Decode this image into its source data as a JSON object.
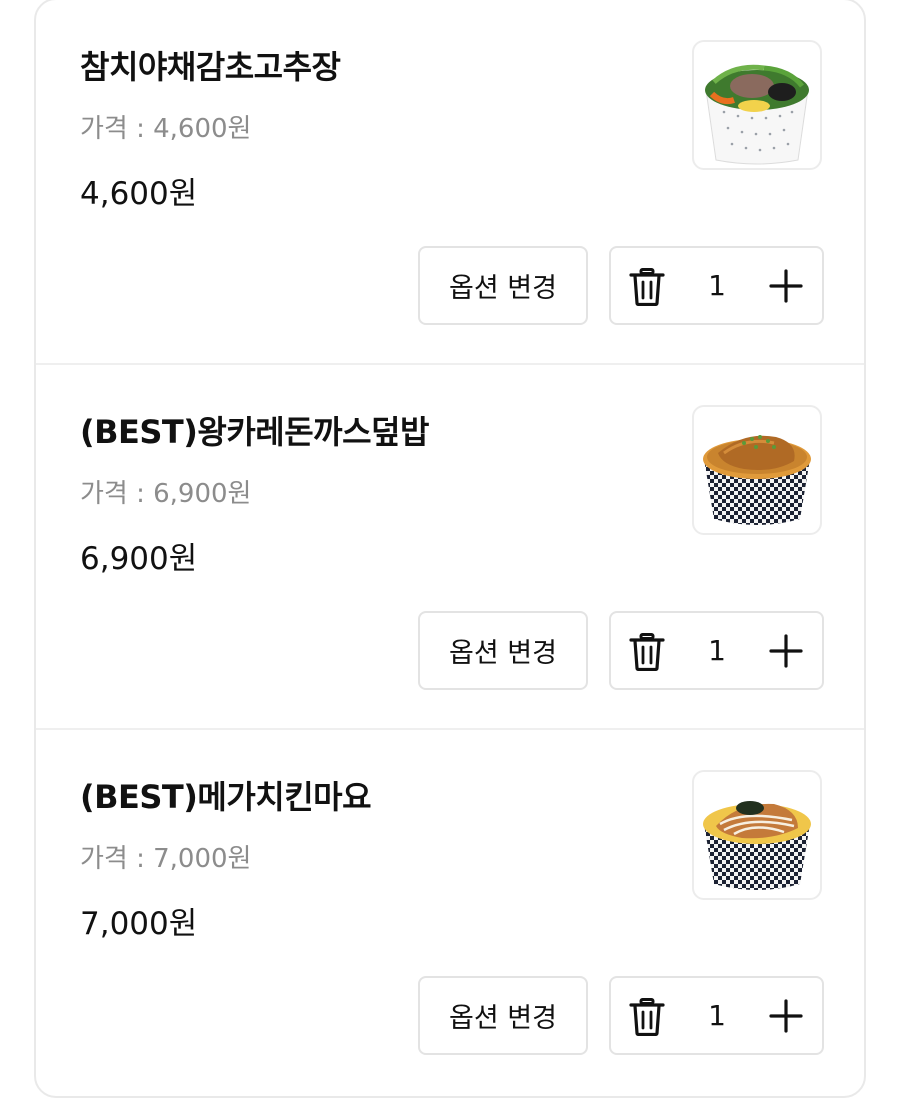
{
  "cart": {
    "items": [
      {
        "name": "참치야채감초고추장",
        "price_label": "가격 : 4,600원",
        "total": "4,600원",
        "option_label": "옵션 변경",
        "quantity": "1",
        "thumbnail_icon": "tuna-vegetable-bibimbap-bowl"
      },
      {
        "name": "(BEST)왕카레돈까스덮밥",
        "price_label": "가격 : 6,900원",
        "total": "6,900원",
        "option_label": "옵션 변경",
        "quantity": "1",
        "thumbnail_icon": "curry-pork-cutlet-rice-bowl"
      },
      {
        "name": "(BEST)메가치킨마요",
        "price_label": "가격 : 7,000원",
        "total": "7,000원",
        "option_label": "옵션 변경",
        "quantity": "1",
        "thumbnail_icon": "chicken-mayo-rice-bowl"
      }
    ]
  },
  "colors": {
    "border": "#e3e3e3",
    "muted_text": "#8c8c8c",
    "text": "#111111"
  }
}
